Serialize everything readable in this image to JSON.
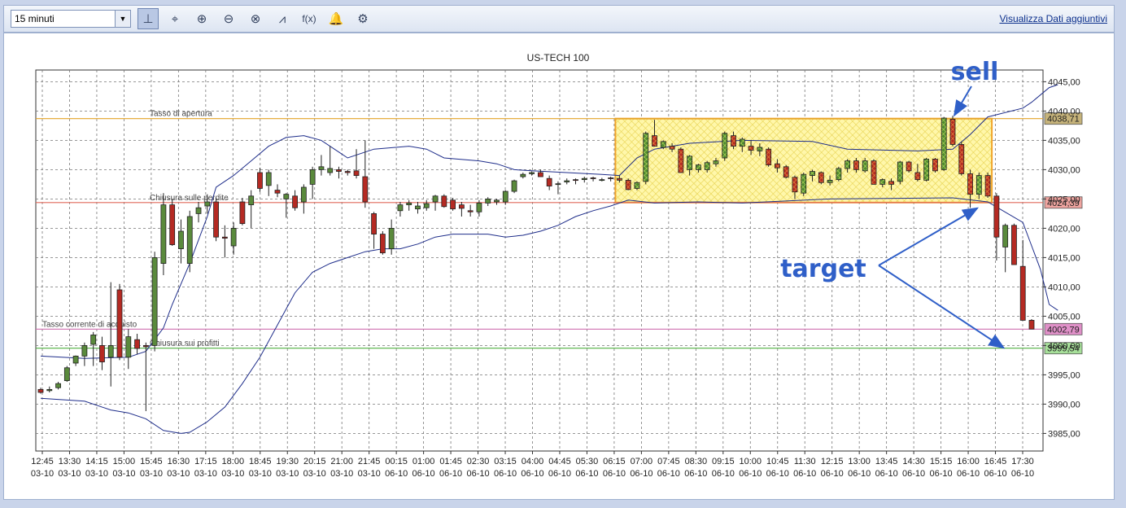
{
  "toolbar": {
    "interval_value": "15 minuti",
    "more_data_link": "Visualizza Dati aggiuntivi",
    "tools": [
      {
        "name": "cursor-tool-icon",
        "glyph": "⊥",
        "active": true
      },
      {
        "name": "crosshair-icon",
        "glyph": "⌖",
        "active": false
      },
      {
        "name": "zoom-in-icon",
        "glyph": "⊕",
        "active": false
      },
      {
        "name": "zoom-out-icon",
        "glyph": "⊖",
        "active": false
      },
      {
        "name": "zoom-reset-icon",
        "glyph": "⊗",
        "active": false
      },
      {
        "name": "trendline-icon",
        "glyph": "⩘",
        "active": false
      },
      {
        "name": "function-icon",
        "glyph": "f(x)",
        "active": false
      },
      {
        "name": "bell-icon",
        "glyph": "🔔",
        "active": false
      },
      {
        "name": "gear-icon",
        "glyph": "⚙",
        "active": false
      }
    ]
  },
  "colors": {
    "up_candle": "#5a8a3c",
    "down_candle": "#b52a23",
    "bollinger": "#1e2d8a",
    "opening_line": "#e5a52a",
    "stop_loss_line": "#e06a5c",
    "current_line": "#d070b0",
    "take_profit_line": "#50b040",
    "highlight_fill": "#fff28a",
    "highlight_border": "#f0a020",
    "annotation_blue": "#2f5fc8"
  },
  "chart_data": {
    "type": "candlestick",
    "title": "US-TECH 100",
    "ylim": [
      3982,
      4047
    ],
    "y_ticks": [
      "3985,00",
      "3990,00",
      "3995,00",
      "4000,00",
      "4005,00",
      "4010,00",
      "4015,00",
      "4020,00",
      "4025,00",
      "4030,00",
      "4035,00",
      "4040,00",
      "4045,00"
    ],
    "x_tick_labels": [
      [
        "12:45",
        "03-10"
      ],
      [
        "13:30",
        "03-10"
      ],
      [
        "14:15",
        "03-10"
      ],
      [
        "15:00",
        "03-10"
      ],
      [
        "15:45",
        "03-10"
      ],
      [
        "16:30",
        "03-10"
      ],
      [
        "17:15",
        "03-10"
      ],
      [
        "18:00",
        "03-10"
      ],
      [
        "18:45",
        "03-10"
      ],
      [
        "19:30",
        "03-10"
      ],
      [
        "20:15",
        "03-10"
      ],
      [
        "21:00",
        "03-10"
      ],
      [
        "21:45",
        "03-10"
      ],
      [
        "00:15",
        "06-10"
      ],
      [
        "01:00",
        "06-10"
      ],
      [
        "01:45",
        "06-10"
      ],
      [
        "02:30",
        "06-10"
      ],
      [
        "03:15",
        "06-10"
      ],
      [
        "04:00",
        "06-10"
      ],
      [
        "04:45",
        "06-10"
      ],
      [
        "05:30",
        "06-10"
      ],
      [
        "06:15",
        "06-10"
      ],
      [
        "07:00",
        "06-10"
      ],
      [
        "07:45",
        "06-10"
      ],
      [
        "08:30",
        "06-10"
      ],
      [
        "09:15",
        "06-10"
      ],
      [
        "10:00",
        "06-10"
      ],
      [
        "10:45",
        "06-10"
      ],
      [
        "11:30",
        "06-10"
      ],
      [
        "12:15",
        "06-10"
      ],
      [
        "13:00",
        "06-10"
      ],
      [
        "13:45",
        "06-10"
      ],
      [
        "14:30",
        "06-10"
      ],
      [
        "15:15",
        "06-10"
      ],
      [
        "16:00",
        "06-10"
      ],
      [
        "16:45",
        "06-10"
      ],
      [
        "17:30",
        "06-10"
      ]
    ],
    "candles": [
      [
        3992.5,
        3992.8,
        3991.8,
        3992.0
      ],
      [
        3992.3,
        3993.0,
        3992.0,
        3992.5
      ],
      [
        3992.8,
        3993.8,
        3992.5,
        3993.5
      ],
      [
        3994.0,
        3996.5,
        3993.8,
        3996.2
      ],
      [
        3997.0,
        3998.3,
        3996.5,
        3998.2
      ],
      [
        3998.2,
        4000.5,
        3996.5,
        4000.0
      ],
      [
        4000.2,
        4002.3,
        3996.5,
        4001.8
      ],
      [
        4000.0,
        4001.5,
        3995.8,
        3997.2
      ],
      [
        3998.0,
        4010.8,
        3993.0,
        4000.0
      ],
      [
        4009.5,
        4010.5,
        3997.5,
        3998.0
      ],
      [
        3998.0,
        4002.8,
        3996.0,
        4001.5
      ],
      [
        4001.0,
        4002.0,
        3998.5,
        3999.5
      ],
      [
        4000.0,
        4000.5,
        3988.8,
        3999.8
      ],
      [
        4000.0,
        4016.0,
        3999.0,
        4015.0
      ],
      [
        4014.0,
        4026.0,
        4012.0,
        4024.0
      ],
      [
        4024.0,
        4025.0,
        4017.0,
        4017.2
      ],
      [
        4016.5,
        4021.5,
        4014.0,
        4019.5
      ],
      [
        4014.0,
        4023.0,
        4012.5,
        4022.0
      ],
      [
        4022.5,
        4024.5,
        4021.0,
        4023.5
      ],
      [
        4023.8,
        4025.8,
        4022.5,
        4024.5
      ],
      [
        4024.5,
        4025.2,
        4017.8,
        4018.5
      ],
      [
        4018.5,
        4020.5,
        4015.0,
        4018.3
      ],
      [
        4017.0,
        4021.0,
        4015.5,
        4020.0
      ],
      [
        4024.5,
        4025.2,
        4020.5,
        4020.8
      ],
      [
        4024.0,
        4026.5,
        4020.0,
        4025.5
      ],
      [
        4029.5,
        4030.3,
        4026.2,
        4026.8
      ],
      [
        4027.3,
        4030.0,
        4025.5,
        4029.5
      ],
      [
        4026.5,
        4027.5,
        4025.3,
        4026.0
      ],
      [
        4025.0,
        4026.0,
        4021.8,
        4025.8
      ],
      [
        4025.5,
        4026.5,
        4023.0,
        4023.5
      ],
      [
        4024.5,
        4027.5,
        4022.5,
        4027.0
      ],
      [
        4027.5,
        4030.5,
        4025.0,
        4030.0
      ],
      [
        4030.0,
        4032.5,
        4029.0,
        4030.5
      ],
      [
        4029.5,
        4034.0,
        4029.0,
        4030.2
      ],
      [
        4030.0,
        4030.5,
        4028.5,
        4029.7
      ],
      [
        4029.7,
        4030.0,
        4029.0,
        4029.5
      ],
      [
        4029.8,
        4033.5,
        4028.5,
        4029.0
      ],
      [
        4028.8,
        4035.0,
        4023.5,
        4024.5
      ],
      [
        4022.5,
        4022.8,
        4016.5,
        4019.0
      ],
      [
        4019.0,
        4019.5,
        4015.5,
        4015.8
      ],
      [
        4016.5,
        4021.5,
        4015.5,
        4020.0
      ],
      [
        4023.0,
        4024.5,
        4022.0,
        4024.0
      ],
      [
        4024.0,
        4024.8,
        4023.0,
        4024.3
      ],
      [
        4023.3,
        4024.5,
        4022.5,
        4023.8
      ],
      [
        4023.5,
        4024.8,
        4023.0,
        4024.2
      ],
      [
        4024.5,
        4025.7,
        4023.0,
        4025.5
      ],
      [
        4025.5,
        4025.8,
        4023.5,
        4023.7
      ],
      [
        4024.8,
        4025.2,
        4023.0,
        4023.3
      ],
      [
        4024.0,
        4024.5,
        4022.0,
        4023.4
      ],
      [
        4023.0,
        4024.0,
        4022.0,
        4022.8
      ],
      [
        4022.8,
        4024.8,
        4022.0,
        4024.3
      ],
      [
        4024.3,
        4025.3,
        4023.8,
        4025.0
      ],
      [
        4024.5,
        4025.0,
        4024.0,
        4024.8
      ],
      [
        4024.5,
        4026.5,
        4024.0,
        4026.3
      ],
      [
        4026.3,
        4028.3,
        4026.0,
        4028.1
      ],
      [
        4028.8,
        4029.5,
        4028.5,
        4029.2
      ],
      [
        4029.3,
        4029.7,
        4029.0,
        4029.5
      ],
      [
        4029.5,
        4030.0,
        4028.8,
        4028.8
      ],
      [
        4028.5,
        4029.0,
        4026.5,
        4027.2
      ],
      [
        4027.5,
        4028.0,
        4025.8,
        4027.6
      ],
      [
        4027.9,
        4028.5,
        4027.5,
        4028.1
      ],
      [
        4028.3,
        4028.5,
        4027.5,
        4028.2
      ],
      [
        4028.3,
        4028.8,
        4027.8,
        4028.5
      ],
      [
        4028.6,
        4028.8,
        4028.0,
        4028.5
      ],
      [
        4028.3,
        4028.6,
        4028.0,
        4028.3
      ],
      [
        4028.6,
        4028.8,
        4028.0,
        4028.5
      ],
      [
        4028.5,
        4029.0,
        4027.8,
        4028.2
      ],
      [
        4028.2,
        4028.5,
        4026.5,
        4026.6
      ],
      [
        4026.8,
        4028.0,
        4026.5,
        4027.8
      ],
      [
        4028.0,
        4036.5,
        4027.5,
        4036.2
      ],
      [
        4035.8,
        4038.5,
        4034.0,
        4034.0
      ],
      [
        4033.8,
        4035.0,
        4033.5,
        4034.8
      ],
      [
        4034.0,
        4034.5,
        4033.0,
        4033.5
      ],
      [
        4033.5,
        4033.8,
        4029.5,
        4029.5
      ],
      [
        4030.0,
        4032.5,
        4029.0,
        4032.3
      ],
      [
        4030.0,
        4031.0,
        4029.5,
        4030.8
      ],
      [
        4030.0,
        4031.5,
        4029.5,
        4031.2
      ],
      [
        4031.0,
        4032.0,
        4030.5,
        4031.5
      ],
      [
        4032.0,
        4036.5,
        4031.5,
        4036.2
      ],
      [
        4035.8,
        4036.5,
        4033.5,
        4034.0
      ],
      [
        4034.0,
        4035.5,
        4033.0,
        4035.2
      ],
      [
        4034.0,
        4035.0,
        4032.5,
        4033.3
      ],
      [
        4033.2,
        4034.5,
        4032.3,
        4033.8
      ],
      [
        4033.5,
        4033.8,
        4030.5,
        4030.8
      ],
      [
        4031.0,
        4031.8,
        4029.5,
        4030.3
      ],
      [
        4030.5,
        4030.8,
        4028.5,
        4028.7
      ],
      [
        4028.7,
        4029.0,
        4025.0,
        4026.2
      ],
      [
        4026.0,
        4029.5,
        4025.5,
        4029.2
      ],
      [
        4029.0,
        4030.0,
        4028.0,
        4029.7
      ],
      [
        4029.5,
        4029.7,
        4027.5,
        4027.8
      ],
      [
        4027.8,
        4029.0,
        4027.3,
        4028.2
      ],
      [
        4028.3,
        4030.5,
        4028.0,
        4030.2
      ],
      [
        4030.2,
        4031.8,
        4029.5,
        4031.5
      ],
      [
        4031.5,
        4032.0,
        4029.5,
        4030.0
      ],
      [
        4029.8,
        4032.0,
        4029.5,
        4031.5
      ],
      [
        4031.5,
        4031.8,
        4027.5,
        4027.5
      ],
      [
        4027.5,
        4028.5,
        4027.0,
        4028.3
      ],
      [
        4028.0,
        4028.5,
        4026.5,
        4027.5
      ],
      [
        4028.0,
        4031.5,
        4027.5,
        4031.3
      ],
      [
        4031.3,
        4031.5,
        4029.5,
        4029.8
      ],
      [
        4029.5,
        4031.0,
        4028.0,
        4028.3
      ],
      [
        4028.2,
        4032.0,
        4028.0,
        4031.8
      ],
      [
        4031.8,
        4032.0,
        4029.5,
        4029.8
      ],
      [
        4030.0,
        4039.0,
        4029.8,
        4038.8
      ],
      [
        4038.6,
        4039.2,
        4034.0,
        4034.3
      ],
      [
        4034.3,
        4034.8,
        4029.0,
        4029.3
      ],
      [
        4029.3,
        4030.0,
        4023.5,
        4025.8
      ],
      [
        4025.8,
        4029.5,
        4025.0,
        4029.0
      ],
      [
        4029.0,
        4029.5,
        4025.2,
        4025.5
      ],
      [
        4025.5,
        4026.0,
        4014.5,
        4018.5
      ],
      [
        4016.8,
        4020.8,
        4012.5,
        4020.5
      ],
      [
        4020.5,
        4020.8,
        4015.5,
        4013.8
      ],
      [
        4013.5,
        4018.0,
        4007.5,
        4004.3
      ],
      [
        4004.3,
        4004.5,
        4002.8,
        4002.8
      ]
    ],
    "bollinger_upper": [
      [
        0,
        3998.2
      ],
      [
        5,
        3997.8
      ],
      [
        10,
        3998.0
      ],
      [
        12,
        3999.0
      ],
      [
        14,
        4003.0
      ],
      [
        15,
        4007.0
      ],
      [
        17,
        4014.0
      ],
      [
        19,
        4022.0
      ],
      [
        20,
        4027.0
      ],
      [
        22,
        4029.0
      ],
      [
        24,
        4031.5
      ],
      [
        26,
        4034.0
      ],
      [
        28,
        4035.5
      ],
      [
        30,
        4035.8
      ],
      [
        32,
        4035.0
      ],
      [
        34,
        4033.0
      ],
      [
        35,
        4032.0
      ],
      [
        38,
        4033.5
      ],
      [
        42,
        4034.0
      ],
      [
        44,
        4033.5
      ],
      [
        46,
        4032.0
      ],
      [
        50,
        4031.5
      ],
      [
        52,
        4031.0
      ],
      [
        54,
        4030.0
      ],
      [
        56,
        4029.8
      ],
      [
        60,
        4029.5
      ],
      [
        64,
        4029.2
      ],
      [
        66,
        4029.0
      ],
      [
        67,
        4030.5
      ],
      [
        68,
        4032.0
      ],
      [
        70,
        4033.5
      ],
      [
        74,
        4034.5
      ],
      [
        80,
        4035.0
      ],
      [
        88,
        4034.8
      ],
      [
        92,
        4033.5
      ],
      [
        100,
        4033.2
      ],
      [
        104,
        4033.5
      ],
      [
        106,
        4036.0
      ],
      [
        108,
        4039.0
      ],
      [
        112,
        4040.5
      ],
      [
        113,
        4041.5
      ],
      [
        115,
        4044.0
      ],
      [
        116,
        4044.5
      ]
    ],
    "bollinger_lower": [
      [
        0,
        3991.0
      ],
      [
        5,
        3990.5
      ],
      [
        8,
        3989.0
      ],
      [
        10,
        3988.5
      ],
      [
        12,
        3987.5
      ],
      [
        14,
        3985.5
      ],
      [
        16,
        3985.0
      ],
      [
        17,
        3985.2
      ],
      [
        19,
        3987.0
      ],
      [
        21,
        3989.5
      ],
      [
        23,
        3993.5
      ],
      [
        25,
        3998.0
      ],
      [
        27,
        4003.5
      ],
      [
        29,
        4009.0
      ],
      [
        31,
        4012.5
      ],
      [
        33,
        4014.0
      ],
      [
        35,
        4015.0
      ],
      [
        37,
        4016.0
      ],
      [
        39,
        4016.5
      ],
      [
        41,
        4016.5
      ],
      [
        43,
        4017.3
      ],
      [
        45,
        4018.5
      ],
      [
        47,
        4019.0
      ],
      [
        49,
        4019.0
      ],
      [
        51,
        4019.0
      ],
      [
        53,
        4018.5
      ],
      [
        55,
        4018.8
      ],
      [
        57,
        4019.5
      ],
      [
        59,
        4020.5
      ],
      [
        61,
        4022.0
      ],
      [
        63,
        4023.0
      ],
      [
        65,
        4023.8
      ],
      [
        67,
        4024.8
      ],
      [
        70,
        4024.3
      ],
      [
        75,
        4024.5
      ],
      [
        80,
        4024.3
      ],
      [
        90,
        4025.0
      ],
      [
        104,
        4025.2
      ],
      [
        108,
        4024.5
      ],
      [
        112,
        4021.0
      ],
      [
        113,
        4017.0
      ],
      [
        114,
        4013.0
      ],
      [
        115,
        4007.0
      ],
      [
        116,
        4006.0
      ]
    ],
    "levels": [
      {
        "label": "Tasso di apertura",
        "value": 4038.71,
        "value_text": "4038,71",
        "color_key": "opening_line",
        "label_bg": "#c6b37a"
      },
      {
        "label": "Chiusura sulle perdite",
        "value": 4024.39,
        "value_text": "4024,39",
        "color_key": "stop_loss_line",
        "label_bg": "#f0a5a0"
      },
      {
        "label": "Tasso corrente di acquisto",
        "value": 4002.79,
        "value_text": "4002,79",
        "color_key": "current_line",
        "label_bg": "#e090c8"
      },
      {
        "label": "Chiusura sui profitti",
        "value": 3999.54,
        "value_text": "3999,54",
        "color_key": "take_profit_line",
        "label_bg": "#a7e09a"
      }
    ],
    "highlight_zone": {
      "from_index": 66,
      "to_index": 108,
      "high": 4038.71,
      "low": 4024.39
    },
    "annotations": [
      {
        "text": "sell",
        "anchor_index": 104,
        "anchor_value": 4039.0
      },
      {
        "text": "target",
        "targets": [
          {
            "index": 107,
            "value": 4024.0
          },
          {
            "index": 110,
            "value": 3999.6
          }
        ]
      }
    ]
  }
}
